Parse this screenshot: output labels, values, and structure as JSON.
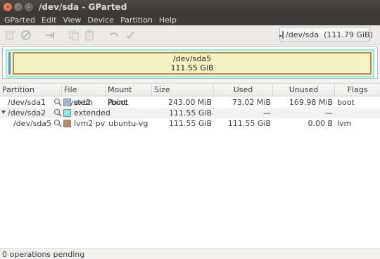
{
  "window": {
    "title": "/dev/sda - GParted"
  },
  "window_controls": {
    "close_glyph": "×",
    "minimize_glyph": "–",
    "maximize_glyph": "□"
  },
  "menu": {
    "items": [
      "GParted",
      "Edit",
      "View",
      "Device",
      "Partition",
      "Help"
    ]
  },
  "toolbar": {
    "icons": [
      "new-partition-icon",
      "delete-icon",
      "resize-move-icon",
      "copy-icon",
      "paste-icon",
      "undo-icon",
      "apply-icon"
    ],
    "device_selector": "/dev/sda  (111.79 GiB)"
  },
  "visual": {
    "partition_name": "/dev/sda5",
    "partition_size": "111.55 GiB",
    "colors": {
      "extended": "#7eedee",
      "lvm2": "#b88c5a",
      "fill": "#f6f3c2"
    }
  },
  "table": {
    "headers": [
      "Partition",
      "File System",
      "Mount Point",
      "Size",
      "Used",
      "Unused",
      "Flags"
    ],
    "rows": [
      {
        "partition": "/dev/sda1",
        "filesystem": "ext2",
        "fs_color": "#9db8d2",
        "mount": "/boot",
        "size": "243.00 MiB",
        "used": "73.02 MiB",
        "unused": "169.98 MiB",
        "flags": "boot"
      },
      {
        "partition": "/dev/sda2",
        "filesystem": "extended",
        "fs_color": "#7eedee",
        "mount": "",
        "size": "111.55 GiB",
        "used": "—",
        "unused": "—",
        "flags": ""
      },
      {
        "partition": "/dev/sda5",
        "filesystem": "lvm2 pv",
        "fs_color": "#b88c5a",
        "mount": "ubuntu-vg",
        "size": "111.55 GiB",
        "used": "111.55 GiB",
        "unused": "0.00 B",
        "flags": "lvm"
      }
    ]
  },
  "status": {
    "text": "0 operations pending"
  }
}
